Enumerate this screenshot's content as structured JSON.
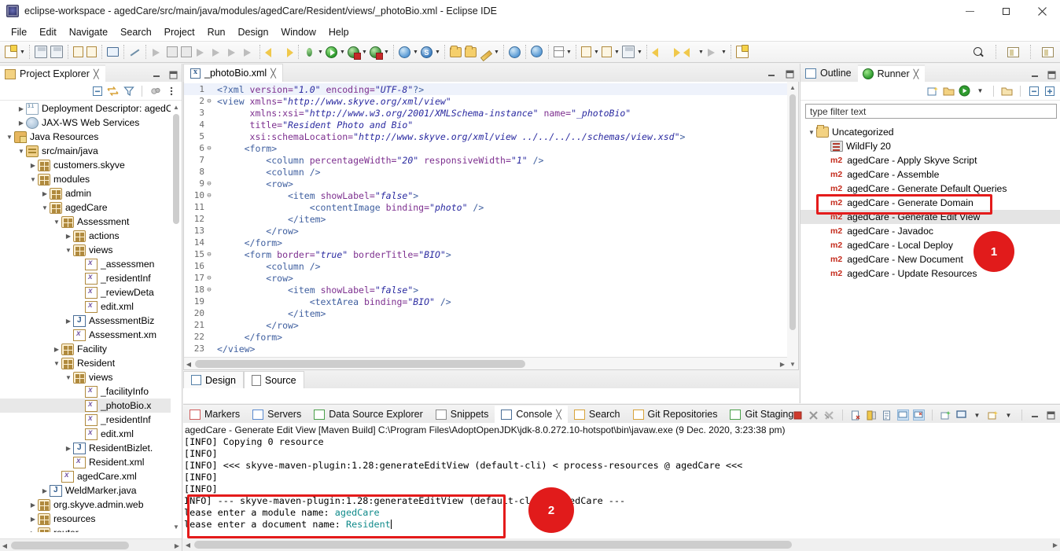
{
  "window": {
    "title": "eclipse-workspace - agedCare/src/main/java/modules/agedCare/Resident/views/_photoBio.xml - Eclipse IDE",
    "minimize": "–",
    "maximize": "❐",
    "close": "✕"
  },
  "menubar": {
    "items": [
      "File",
      "Edit",
      "Navigate",
      "Search",
      "Project",
      "Run",
      "Design",
      "Window",
      "Help"
    ]
  },
  "project_explorer": {
    "tab_label": "Project Explorer",
    "close_glyph": "╳",
    "toolbar": [
      "collapse-all-icon",
      "link-with-editor-icon",
      "view-menu-filter-icon",
      "focus-icon",
      "view-menu-icon"
    ],
    "tree": [
      {
        "indent": 1,
        "twist": ">",
        "icon": "deployment-descriptor-icon",
        "label": "Deployment Descriptor: agedC"
      },
      {
        "indent": 1,
        "twist": ">",
        "icon": "web-services-icon",
        "label": "JAX-WS Web Services"
      },
      {
        "indent": 0,
        "twist": "v",
        "icon": "java-resources-icon",
        "label": "Java Resources"
      },
      {
        "indent": 1,
        "twist": "v",
        "icon": "source-folder-icon",
        "label": "src/main/java"
      },
      {
        "indent": 2,
        "twist": ">",
        "icon": "package-icon",
        "label": "customers.skyve"
      },
      {
        "indent": 2,
        "twist": "v",
        "icon": "package-icon",
        "label": "modules"
      },
      {
        "indent": 3,
        "twist": ">",
        "icon": "package-icon",
        "label": "admin"
      },
      {
        "indent": 3,
        "twist": "v",
        "icon": "package-icon",
        "label": "agedCare"
      },
      {
        "indent": 4,
        "twist": "v",
        "icon": "package-icon",
        "label": "Assessment"
      },
      {
        "indent": 5,
        "twist": ">",
        "icon": "package-icon",
        "label": "actions"
      },
      {
        "indent": 5,
        "twist": "v",
        "icon": "package-icon",
        "label": "views"
      },
      {
        "indent": 6,
        "twist": "",
        "icon": "xml-file-icon",
        "label": "_assessmen"
      },
      {
        "indent": 6,
        "twist": "",
        "icon": "xml-file-icon",
        "label": "_residentInf"
      },
      {
        "indent": 6,
        "twist": "",
        "icon": "xml-file-icon",
        "label": "_reviewDeta"
      },
      {
        "indent": 6,
        "twist": "",
        "icon": "xml-file-icon",
        "label": "edit.xml"
      },
      {
        "indent": 5,
        "twist": ">",
        "icon": "java-file-icon",
        "label": "AssessmentBiz"
      },
      {
        "indent": 5,
        "twist": "",
        "icon": "xml-file-icon",
        "label": "Assessment.xm"
      },
      {
        "indent": 4,
        "twist": ">",
        "icon": "package-icon",
        "label": "Facility"
      },
      {
        "indent": 4,
        "twist": "v",
        "icon": "package-icon",
        "label": "Resident"
      },
      {
        "indent": 5,
        "twist": "v",
        "icon": "package-icon",
        "label": "views"
      },
      {
        "indent": 6,
        "twist": "",
        "icon": "xml-file-icon",
        "label": "_facilityInfo"
      },
      {
        "indent": 6,
        "twist": "",
        "icon": "xml-file-icon",
        "label": "_photoBio.x",
        "selected": true
      },
      {
        "indent": 6,
        "twist": "",
        "icon": "xml-file-icon",
        "label": "_residentInf"
      },
      {
        "indent": 6,
        "twist": "",
        "icon": "xml-file-icon",
        "label": "edit.xml"
      },
      {
        "indent": 5,
        "twist": ">",
        "icon": "java-file-icon",
        "label": "ResidentBizlet."
      },
      {
        "indent": 5,
        "twist": "",
        "icon": "xml-file-icon",
        "label": "Resident.xml"
      },
      {
        "indent": 4,
        "twist": "",
        "icon": "xml-file-icon",
        "label": "agedCare.xml"
      },
      {
        "indent": 3,
        "twist": ">",
        "icon": "java-file-icon",
        "label": "WeldMarker.java"
      },
      {
        "indent": 2,
        "twist": ">",
        "icon": "package-icon",
        "label": "org.skyve.admin.web"
      },
      {
        "indent": 2,
        "twist": ">",
        "icon": "package-icon",
        "label": "resources"
      },
      {
        "indent": 2,
        "twist": ">",
        "icon": "package-icon",
        "label": "router"
      }
    ]
  },
  "editor": {
    "tab_label": "_photoBio.xml",
    "tab_close_glyph": "╳",
    "page_tabs": [
      {
        "label": "Design",
        "icon": "design-view-icon",
        "active": false
      },
      {
        "label": "Source",
        "icon": "source-view-icon",
        "active": true
      }
    ],
    "lines": [
      {
        "n": "1",
        "fold": "",
        "segments": [
          {
            "t": "<?xml ",
            "c": "tg"
          },
          {
            "t": "version=",
            "c": "at"
          },
          {
            "t": "\"1.0\"",
            "c": "vl"
          },
          {
            "t": " encoding=",
            "c": "at"
          },
          {
            "t": "\"UTF-8\"",
            "c": "vl"
          },
          {
            "t": "?>",
            "c": "tg"
          }
        ]
      },
      {
        "n": "2",
        "fold": "⊖",
        "segments": [
          {
            "t": "<view ",
            "c": "tg"
          },
          {
            "t": "xmlns=",
            "c": "at"
          },
          {
            "t": "\"http://www.skyve.org/xml/view\"",
            "c": "vl"
          }
        ]
      },
      {
        "n": "3",
        "fold": "",
        "segments": [
          {
            "t": "      ",
            "c": "tg"
          },
          {
            "t": "xmlns:xsi=",
            "c": "at"
          },
          {
            "t": "\"http://www.w3.org/2001/XMLSchema-instance\"",
            "c": "vl"
          },
          {
            "t": " name=",
            "c": "at"
          },
          {
            "t": "\"_photoBio\"",
            "c": "vl"
          }
        ]
      },
      {
        "n": "4",
        "fold": "",
        "segments": [
          {
            "t": "      ",
            "c": "tg"
          },
          {
            "t": "title=",
            "c": "at"
          },
          {
            "t": "\"Resident Photo and Bio\"",
            "c": "vl"
          }
        ]
      },
      {
        "n": "5",
        "fold": "",
        "segments": [
          {
            "t": "      ",
            "c": "tg"
          },
          {
            "t": "xsi:schemaLocation=",
            "c": "at"
          },
          {
            "t": "\"http://www.skyve.org/xml/view ../../../../schemas/view.xsd\"",
            "c": "vl"
          },
          {
            "t": ">",
            "c": "tg"
          }
        ]
      },
      {
        "n": "6",
        "fold": "⊖",
        "segments": [
          {
            "t": "     <form>",
            "c": "tg"
          }
        ]
      },
      {
        "n": "7",
        "fold": "",
        "segments": [
          {
            "t": "         <column ",
            "c": "tg"
          },
          {
            "t": "percentageWidth=",
            "c": "at"
          },
          {
            "t": "\"20\"",
            "c": "vl"
          },
          {
            "t": " responsiveWidth=",
            "c": "at"
          },
          {
            "t": "\"1\"",
            "c": "vl"
          },
          {
            "t": " />",
            "c": "tg"
          }
        ]
      },
      {
        "n": "8",
        "fold": "",
        "segments": [
          {
            "t": "         <column />",
            "c": "tg"
          }
        ]
      },
      {
        "n": "9",
        "fold": "⊖",
        "segments": [
          {
            "t": "         <row>",
            "c": "tg"
          }
        ]
      },
      {
        "n": "10",
        "fold": "⊖",
        "segments": [
          {
            "t": "             <item ",
            "c": "tg"
          },
          {
            "t": "showLabel=",
            "c": "at"
          },
          {
            "t": "\"false\"",
            "c": "vl"
          },
          {
            "t": ">",
            "c": "tg"
          }
        ]
      },
      {
        "n": "11",
        "fold": "",
        "segments": [
          {
            "t": "                 <contentImage ",
            "c": "tg"
          },
          {
            "t": "binding=",
            "c": "at"
          },
          {
            "t": "\"photo\"",
            "c": "vl"
          },
          {
            "t": " />",
            "c": "tg"
          }
        ]
      },
      {
        "n": "12",
        "fold": "",
        "segments": [
          {
            "t": "             </item>",
            "c": "tg"
          }
        ]
      },
      {
        "n": "13",
        "fold": "",
        "segments": [
          {
            "t": "         </row>",
            "c": "tg"
          }
        ]
      },
      {
        "n": "14",
        "fold": "",
        "segments": [
          {
            "t": "     </form>",
            "c": "tg"
          }
        ]
      },
      {
        "n": "15",
        "fold": "⊖",
        "segments": [
          {
            "t": "     <form ",
            "c": "tg"
          },
          {
            "t": "border=",
            "c": "at"
          },
          {
            "t": "\"true\"",
            "c": "vl"
          },
          {
            "t": " borderTitle=",
            "c": "at"
          },
          {
            "t": "\"BIO\"",
            "c": "vl"
          },
          {
            "t": ">",
            "c": "tg"
          }
        ]
      },
      {
        "n": "16",
        "fold": "",
        "segments": [
          {
            "t": "         <column />",
            "c": "tg"
          }
        ]
      },
      {
        "n": "17",
        "fold": "⊖",
        "segments": [
          {
            "t": "         <row>",
            "c": "tg"
          }
        ]
      },
      {
        "n": "18",
        "fold": "⊖",
        "segments": [
          {
            "t": "             <item ",
            "c": "tg"
          },
          {
            "t": "showLabel=",
            "c": "at"
          },
          {
            "t": "\"false\"",
            "c": "vl"
          },
          {
            "t": ">",
            "c": "tg"
          }
        ]
      },
      {
        "n": "19",
        "fold": "",
        "segments": [
          {
            "t": "                 <textArea ",
            "c": "tg"
          },
          {
            "t": "binding=",
            "c": "at"
          },
          {
            "t": "\"BIO\"",
            "c": "vl"
          },
          {
            "t": " />",
            "c": "tg"
          }
        ]
      },
      {
        "n": "20",
        "fold": "",
        "segments": [
          {
            "t": "             </item>",
            "c": "tg"
          }
        ]
      },
      {
        "n": "21",
        "fold": "",
        "segments": [
          {
            "t": "         </row>",
            "c": "tg"
          }
        ]
      },
      {
        "n": "22",
        "fold": "",
        "segments": [
          {
            "t": "     </form>",
            "c": "tg"
          }
        ]
      },
      {
        "n": "23",
        "fold": "",
        "segments": [
          {
            "t": "</view>",
            "c": "tg"
          }
        ]
      }
    ]
  },
  "runner": {
    "tabs": [
      {
        "label": "Outline",
        "icon": "outline-icon",
        "active": false
      },
      {
        "label": "Runner",
        "icon": "runner-play-icon",
        "active": true,
        "close_glyph": "╳"
      }
    ],
    "toolbar": [
      "new-launch-icon",
      "open-launch-config-icon",
      "run-icon",
      "run-dropdown-icon",
      "import-icon",
      "collapse-all-icon",
      "expand-all-icon"
    ],
    "filter_placeholder": "type filter text",
    "items": [
      {
        "indent": 0,
        "twist": "v",
        "icon": "folder-icon",
        "label": "Uncategorized"
      },
      {
        "indent": 1,
        "twist": "",
        "icon": "server-icon",
        "label": "WildFly 20"
      },
      {
        "indent": 1,
        "twist": "",
        "icon": "m2",
        "label": "agedCare - Apply Skyve Script"
      },
      {
        "indent": 1,
        "twist": "",
        "icon": "m2",
        "label": "agedCare - Assemble"
      },
      {
        "indent": 1,
        "twist": "",
        "icon": "m2",
        "label": "agedCare - Generate Default Queries"
      },
      {
        "indent": 1,
        "twist": "",
        "icon": "m2",
        "label": "agedCare - Generate Domain"
      },
      {
        "indent": 1,
        "twist": "",
        "icon": "m2",
        "label": "agedCare - Generate Edit View",
        "selected": true
      },
      {
        "indent": 1,
        "twist": "",
        "icon": "m2",
        "label": "agedCare - Javadoc"
      },
      {
        "indent": 1,
        "twist": "",
        "icon": "m2",
        "label": "agedCare - Local Deploy"
      },
      {
        "indent": 1,
        "twist": "",
        "icon": "m2",
        "label": "agedCare - New Document"
      },
      {
        "indent": 1,
        "twist": "",
        "icon": "m2",
        "label": "agedCare - Update Resources"
      }
    ]
  },
  "console": {
    "tabs": [
      {
        "label": "Markers",
        "icon": "markers-icon",
        "active": false
      },
      {
        "label": "Servers",
        "icon": "servers-icon",
        "active": false
      },
      {
        "label": "Data Source Explorer",
        "icon": "data-source-icon",
        "active": false
      },
      {
        "label": "Snippets",
        "icon": "snippets-icon",
        "active": false
      },
      {
        "label": "Console",
        "icon": "console-icon",
        "active": true,
        "close_glyph": "╳"
      },
      {
        "label": "Search",
        "icon": "search-icon",
        "active": false
      },
      {
        "label": "Git Repositories",
        "icon": "git-repositories-icon",
        "active": false
      },
      {
        "label": "Git Staging",
        "icon": "git-staging-icon",
        "active": false
      }
    ],
    "toolbar": [
      "terminate-icon",
      "remove-launch-icon",
      "remove-all-launches-icon",
      "clear-console-icon",
      "scroll-lock-icon",
      "word-wrap-icon",
      "show-console-on-output-icon",
      "pin-console-icon",
      "new-console-view-icon",
      "display-selected-console-icon",
      "open-console-icon",
      "minimize-icon",
      "maximize-icon"
    ],
    "header": "agedCare - Generate Edit View [Maven Build] C:\\Program Files\\AdoptOpenJDK\\jdk-8.0.272.10-hotspot\\bin\\javaw.exe  (9 Dec. 2020, 3:23:38 pm)",
    "lines": [
      {
        "text": "[INFO] Copying 0 resource"
      },
      {
        "text": "[INFO]"
      },
      {
        "text": "[INFO] <<< skyve-maven-plugin:1.28:generateEditView (default-cli) < process-resources @ agedCare <<<"
      },
      {
        "text": "[INFO]"
      },
      {
        "text": "[INFO]"
      },
      {
        "text": "INFO] --- skyve-maven-plugin:1.28:generateEditView (default-cli) @ agedCare ---"
      },
      {
        "text": "lease enter a module name: ",
        "value": "agedCare"
      },
      {
        "text": "lease enter a document name: ",
        "value": "Resident",
        "caret": true
      }
    ]
  },
  "annotations": [
    {
      "badge": "1",
      "target": "runner-generate-edit-view"
    },
    {
      "badge": "2",
      "target": "console-prompt-block"
    }
  ],
  "colors": {
    "annotation_red": "#e11b1b",
    "m2_red": "#c42b1c",
    "console_value_teal": "#0f8a8a",
    "selection_grey": "#e4e4e4"
  }
}
